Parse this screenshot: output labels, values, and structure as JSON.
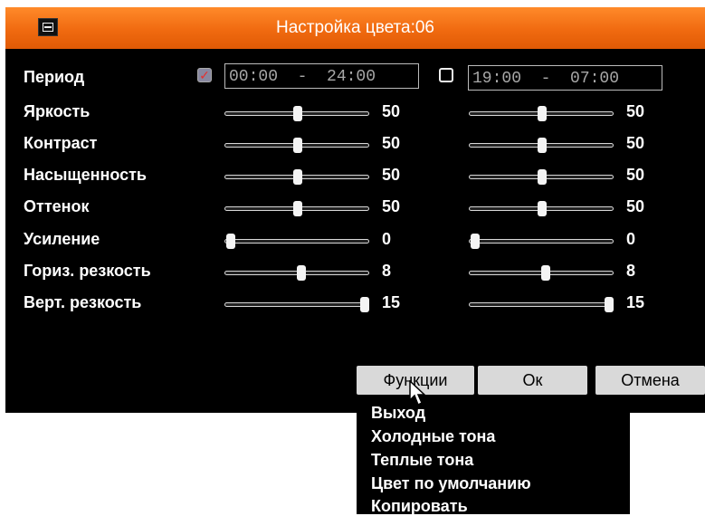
{
  "window": {
    "title": "Настройка цвета:06"
  },
  "period": {
    "label": "Период",
    "schedule1": {
      "enabled": true,
      "check_mark": "✓",
      "time": "00:00  -  24:00"
    },
    "schedule2": {
      "enabled": false,
      "time": "19:00  -  07:00"
    }
  },
  "settings": [
    {
      "label": "Яркость",
      "value1": "50",
      "value2": "50",
      "level1": 0.5,
      "level2": 0.5
    },
    {
      "label": "Контраст",
      "value1": "50",
      "value2": "50",
      "level1": 0.5,
      "level2": 0.5
    },
    {
      "label": "Насыщенность",
      "value1": "50",
      "value2": "50",
      "level1": 0.5,
      "level2": 0.5
    },
    {
      "label": "Оттенок",
      "value1": "50",
      "value2": "50",
      "level1": 0.5,
      "level2": 0.5
    },
    {
      "label": "Усиление",
      "value1": "0",
      "value2": "0",
      "level1": 0.0,
      "level2": 0.0
    },
    {
      "label": "Гориз. резкость",
      "value1": "8",
      "value2": "8",
      "level1": 0.53,
      "level2": 0.53
    },
    {
      "label": "Верт. резкость",
      "value1": "15",
      "value2": "15",
      "level1": 1.0,
      "level2": 1.0
    }
  ],
  "buttons": {
    "functions": "Функции",
    "ok": "Ок",
    "cancel": "Отмена"
  },
  "functions_menu": {
    "items": [
      "Выход",
      "Холодные тона",
      "Теплые тона",
      "Цвет по умолчанию",
      "Копировать"
    ]
  },
  "colors": {
    "titlebar": "#f07015",
    "background": "#000000",
    "text": "#ffffff"
  },
  "icons": {
    "title": "window-icon",
    "cursor": "mouse-pointer-icon"
  }
}
